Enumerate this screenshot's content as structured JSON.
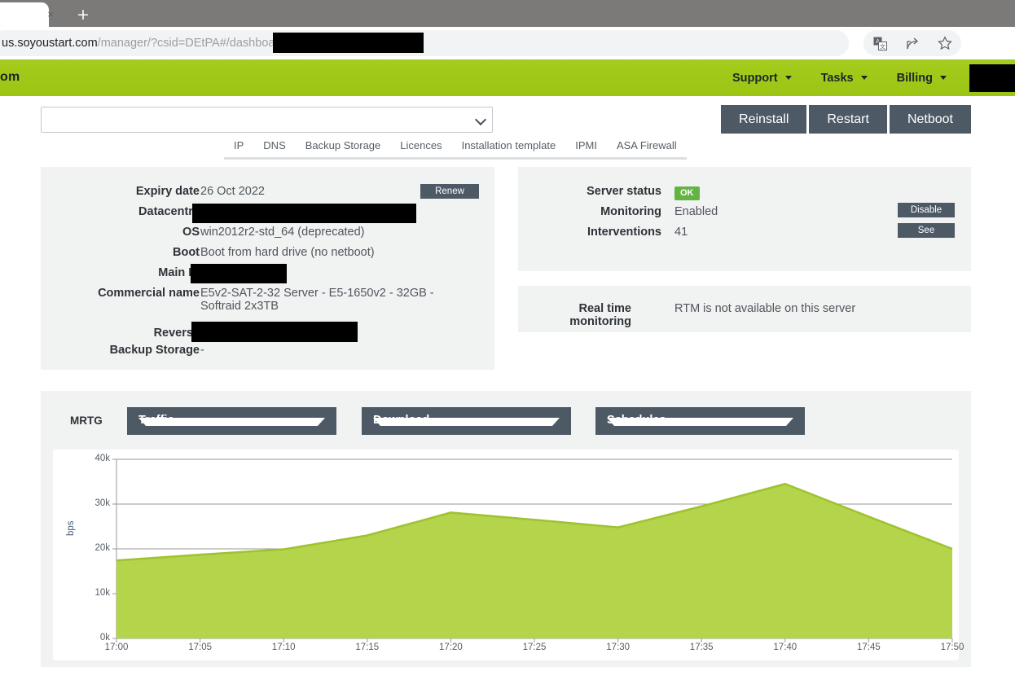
{
  "browser": {
    "tab_close_label": "×",
    "new_tab_label": "+",
    "url_visible": "us.soyoustart.com",
    "url_path": "/manager/?csid=DEtPA#/dashboard",
    "icons": [
      "translate-icon",
      "share-icon",
      "bookmark-star-icon"
    ]
  },
  "header": {
    "brand_fragment": "om",
    "nav": [
      {
        "label": "Support",
        "has_caret": true
      },
      {
        "label": "Tasks",
        "has_caret": true
      },
      {
        "label": "Billing",
        "has_caret": true
      }
    ],
    "accent_color": "#9fc918"
  },
  "toolbar": {
    "server_select_value": "",
    "buttons": [
      {
        "label": "Reinstall"
      },
      {
        "label": "Restart"
      },
      {
        "label": "Netboot"
      }
    ],
    "button_color": "#4d5a66"
  },
  "tabs": [
    {
      "label": "IP"
    },
    {
      "label": "DNS"
    },
    {
      "label": "Backup Storage"
    },
    {
      "label": "Licences"
    },
    {
      "label": "Installation template"
    },
    {
      "label": "IPMI"
    },
    {
      "label": "ASA Firewall"
    }
  ],
  "server_info": {
    "expiry_date_label": "Expiry date",
    "expiry_date_value": "26 Oct 2022",
    "renew_label": "Renew",
    "datacentre_label": "Datacentre",
    "datacentre_value": "",
    "os_label": "OS",
    "os_value": "win2012r2-std_64 (deprecated)",
    "boot_label": "Boot",
    "boot_value": "Boot from hard drive (no netboot)",
    "main_ip_label": "Main IP",
    "main_ip_value": "",
    "commercial_name_label": "Commercial name",
    "commercial_name_value": "E5v2-SAT-2-32 Server - E5-1650v2 - 32GB - Softraid 2x3TB",
    "reverse_label": "Reverse",
    "reverse_value": "",
    "backup_storage_label": "Backup Storage",
    "backup_storage_value": "-"
  },
  "status_panel": {
    "server_status_label": "Server status",
    "server_status_value": "OK",
    "server_status_color": "#62b543",
    "monitoring_label": "Monitoring",
    "monitoring_value": "Enabled",
    "monitoring_action": "Disable",
    "interventions_label": "Interventions",
    "interventions_value": "41",
    "interventions_action": "See"
  },
  "rtm_panel": {
    "label": "Real time monitoring",
    "value": "RTM is not available on this server"
  },
  "mrtg": {
    "label": "MRTG",
    "dropdowns": [
      {
        "name": "metric",
        "value": "Traffic"
      },
      {
        "name": "direction",
        "value": "Download"
      },
      {
        "name": "period",
        "value": "Schedules"
      }
    ]
  },
  "chart_data": {
    "type": "area",
    "title": "",
    "xlabel": "",
    "ylabel": "bps",
    "grid": true,
    "legend": null,
    "ylim": [
      0,
      40000
    ],
    "ytick_labels": [
      "0k",
      "10k",
      "20k",
      "30k",
      "40k"
    ],
    "ytick_values": [
      0,
      10000,
      20000,
      30000,
      40000
    ],
    "x": [
      "17:00",
      "17:05",
      "17:10",
      "17:15",
      "17:20",
      "17:25",
      "17:30",
      "17:35",
      "17:40",
      "17:45",
      "17:50"
    ],
    "series": [
      {
        "name": "Download",
        "color": "#b4d44b",
        "line_color": "#9fc22f",
        "values": [
          17400,
          18700,
          19900,
          23000,
          28100,
          26500,
          24800,
          29500,
          34500,
          27200,
          20000
        ]
      }
    ]
  }
}
